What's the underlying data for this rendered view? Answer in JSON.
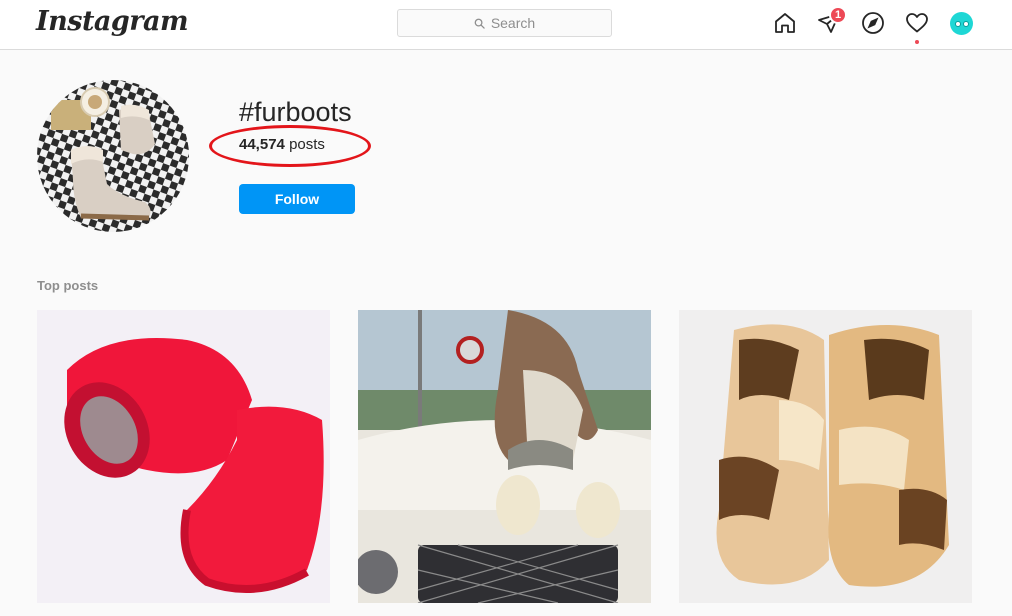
{
  "app": {
    "logo_text": "Instagram"
  },
  "search": {
    "placeholder": "Search"
  },
  "nav": {
    "icons": [
      "home-icon",
      "direct-messages-icon",
      "explore-icon",
      "activity-icon",
      "profile-avatar"
    ],
    "direct_badge": "1"
  },
  "hashtag": {
    "title": "#furboots",
    "post_count": "44,574",
    "post_count_suffix": "posts",
    "follow_label": "Follow"
  },
  "top_posts": {
    "label": "Top posts",
    "items": [
      {
        "subject": "red fur boots"
      },
      {
        "subject": "woman on white car"
      },
      {
        "subject": "brown patterned fur boots"
      }
    ]
  },
  "colors": {
    "accent_blue": "#0095f6",
    "badge_red": "#ed4956",
    "annotation_red": "#e3151a",
    "border": "#dbdbdb",
    "background": "#fafafa"
  }
}
